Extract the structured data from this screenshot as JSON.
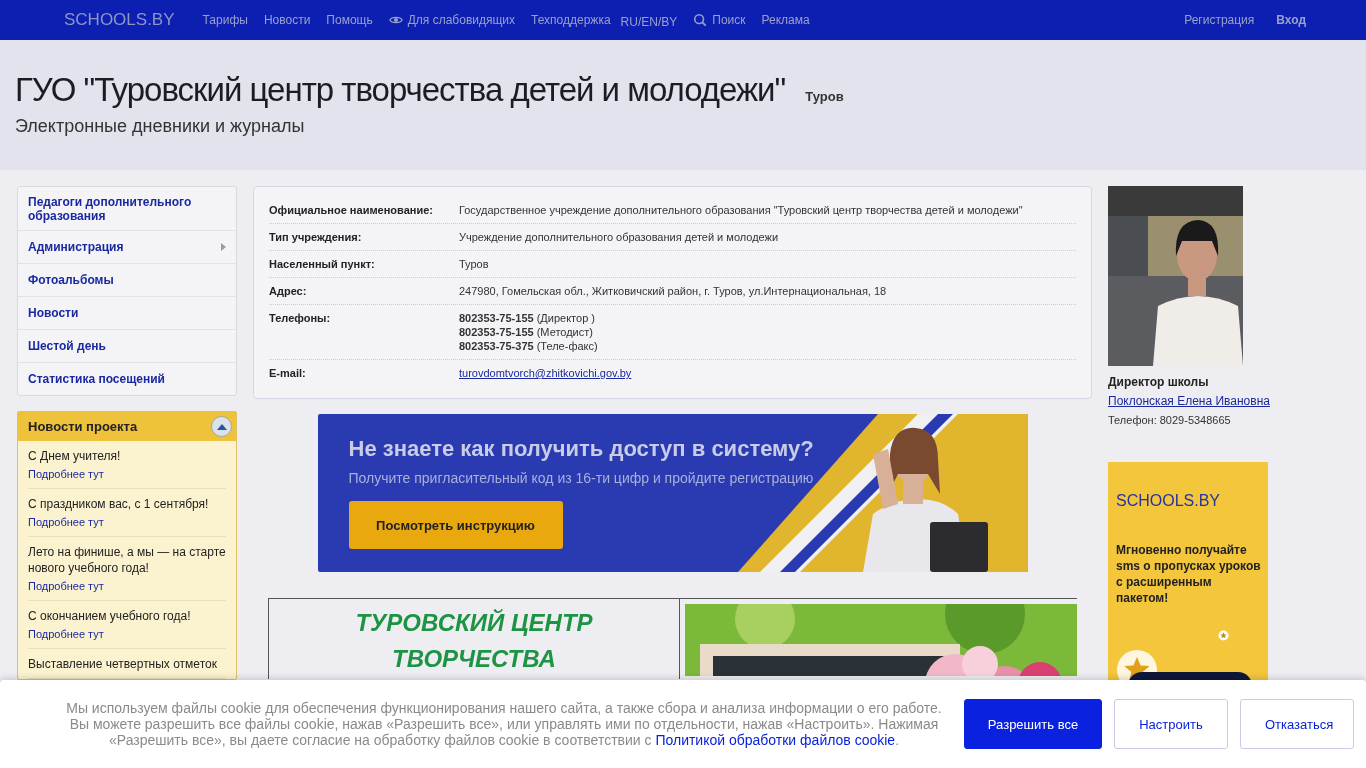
{
  "nav": {
    "logo": "SCHOOLS.BY",
    "items": [
      {
        "label": "Тарифы",
        "kind": "link"
      },
      {
        "label": "Новости",
        "kind": "link"
      },
      {
        "label": "Помощь",
        "kind": "link"
      },
      {
        "label": "Для слабовидящих",
        "kind": "eye"
      },
      {
        "label": "Техподдержка",
        "kind": "link"
      },
      {
        "label": "RU/EN/BY",
        "kind": "lang"
      },
      {
        "label": "Поиск",
        "kind": "search"
      },
      {
        "label": "Реклама",
        "kind": "link"
      }
    ],
    "account": [
      {
        "label": "Регистрация",
        "kind": "link"
      },
      {
        "label": "Вход",
        "kind": "strong"
      }
    ]
  },
  "header": {
    "title": "ГУО \"Туровский центр творчества детей и молодежи\"",
    "city": "Туров",
    "subtitle": "Электронные дневники и журналы"
  },
  "sidebar": {
    "menu": [
      {
        "label": "Педагоги дополнительного образования",
        "submenu": false
      },
      {
        "label": "Администрация",
        "submenu": true
      },
      {
        "label": "Фотоальбомы",
        "submenu": false
      },
      {
        "label": "Новости",
        "submenu": false
      },
      {
        "label": "Шестой день",
        "submenu": false
      },
      {
        "label": "Статистика посещений",
        "submenu": false
      }
    ],
    "news": {
      "title": "Новости проекта",
      "expanded": true,
      "items": [
        {
          "text": "С Днем учителя!",
          "link": "Подробнее тут"
        },
        {
          "text": "С праздником вас, с 1 сентября!",
          "link": "Подробнее тут"
        },
        {
          "text": "Лето на финише, а мы — на старте нового учебного года!",
          "link": "Подробнее тут"
        },
        {
          "text": "С окончанием учебного года!",
          "link": "Подробнее тут"
        },
        {
          "text": "Выставление четвертных отметок"
        }
      ]
    }
  },
  "info": {
    "rows": [
      {
        "label": "Официальное наименование:",
        "kind": "text",
        "value": "Государственное учреждение дополнительного образования \"Туровский центр творчества детей и молодежи\""
      },
      {
        "label": "Тип учреждения:",
        "kind": "text",
        "value": "Учреждение дополнительного образования детей и молодежи"
      },
      {
        "label": "Населенный пункт:",
        "kind": "text",
        "value": "Туров"
      },
      {
        "label": "Адрес:",
        "kind": "text",
        "value": "247980, Гомельская обл., Житковичский район, г. Туров, ул.Интернациональная, 18"
      },
      {
        "label": "Телефоны:",
        "kind": "phones",
        "phones": [
          {
            "number": "802353-75-155",
            "note": "(Директор )"
          },
          {
            "number": "802353-75-155",
            "note": "(Методист)"
          },
          {
            "number": "802353-75-375",
            "note": "(Теле-факс)"
          }
        ]
      },
      {
        "label": "E-mail:",
        "kind": "link",
        "value": "turovdomtvorch@zhitkovichi.gov.by"
      }
    ]
  },
  "banner": {
    "title": "Не знаете как получить доступ в систему?",
    "subtitle": "Получите пригласительный код из 16-ти цифр и пройдите регистрацию",
    "button": "Посмотреть инструкцию"
  },
  "welcome": {
    "heading": [
      "ТУРОВСКИЙ ЦЕНТР",
      "ТВОРЧЕСТВА"
    ],
    "picture": {
      "kind": "picture"
    }
  },
  "director": {
    "photo": {
      "kind": "picture"
    },
    "role": "Директор школы",
    "name": "Поклонская Елена Ивановна",
    "phone": "Телефон: 8029-5348665"
  },
  "promo": {
    "logo": "SCHOOLS.BY",
    "text": "Мгновенно получайте sms о пропусках уроков с расширенным пакетом!"
  },
  "cookie": {
    "text": "Мы используем файлы cookie для обеспечения функционирования нашего сайта, а также сбора и анализа информации о его работе. Вы можете разрешить все файлы cookie, нажав «Разрешить все», или управлять ими по отдельности, нажав «Настроить». Нажимая «Разрешить все», вы даете согласие на обработку файлов cookie в соответствии с",
    "link": "Политикой обработки файлов cookie",
    "tail": ".",
    "buttons": [
      {
        "label": "Разрешить все",
        "primary": true
      },
      {
        "label": "Настроить",
        "primary": false
      },
      {
        "label": "Отказаться",
        "primary": false
      }
    ]
  }
}
